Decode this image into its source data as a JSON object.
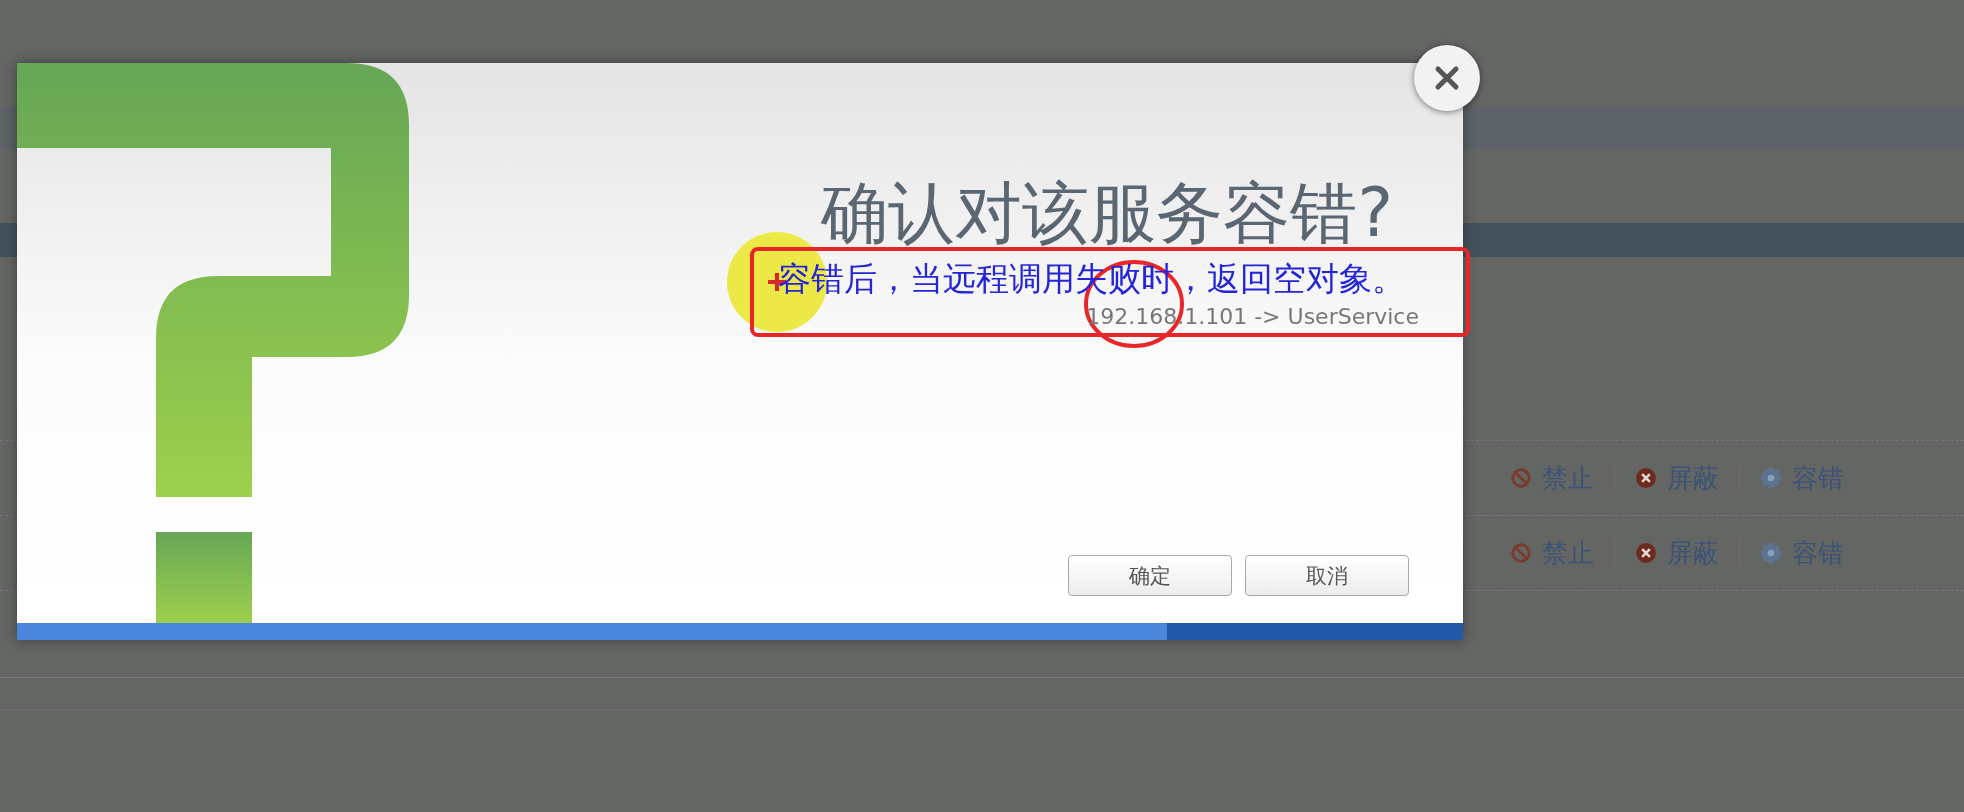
{
  "page": {
    "rows": [
      {
        "actions": [
          {
            "kind": "disable",
            "label": "禁止"
          },
          {
            "kind": "shield",
            "label": "屏蔽"
          },
          {
            "kind": "tolerance",
            "label": "容错"
          }
        ]
      },
      {
        "actions": [
          {
            "kind": "disable",
            "label": "禁止"
          },
          {
            "kind": "shield",
            "label": "屏蔽"
          },
          {
            "kind": "tolerance",
            "label": "容错"
          }
        ]
      }
    ]
  },
  "dialog": {
    "title": "确认对该服务容错?",
    "description": "容错后，当远程调用失败时，返回空对象。",
    "target": "192.168.1.101 -> UserService",
    "buttons": [
      {
        "label": "确定"
      },
      {
        "label": "取消"
      }
    ]
  }
}
